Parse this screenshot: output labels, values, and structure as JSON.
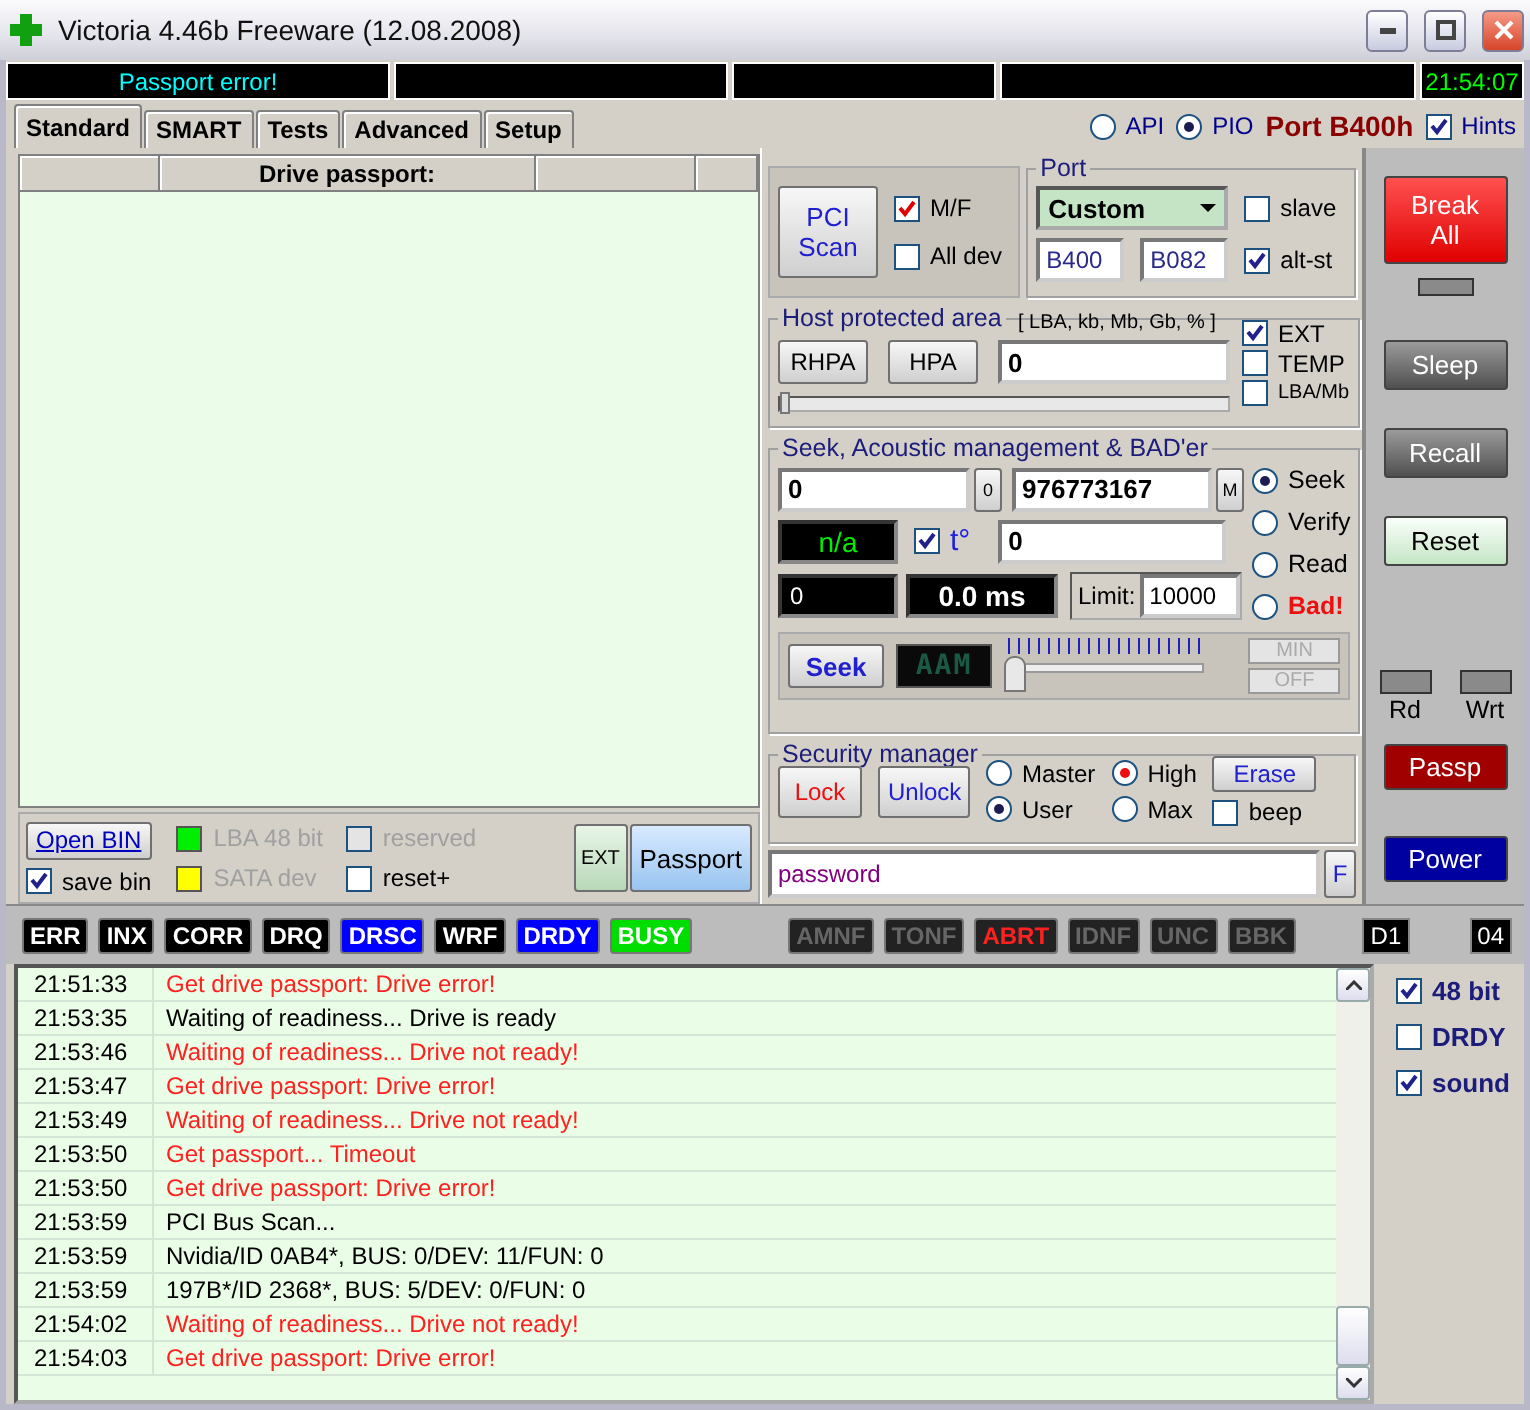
{
  "window": {
    "title": "Victoria 4.46b Freeware (12.08.2008)"
  },
  "status_strip": {
    "message": "Passport error!",
    "clock": "21:54:07"
  },
  "tabs": [
    {
      "label": "Standard",
      "selected": true
    },
    {
      "label": "SMART",
      "selected": false
    },
    {
      "label": "Tests",
      "selected": false
    },
    {
      "label": "Advanced",
      "selected": false
    },
    {
      "label": "Setup",
      "selected": false
    }
  ],
  "access_modes": [
    {
      "label": "API",
      "selected": false
    },
    {
      "label": "PIO",
      "selected": true
    }
  ],
  "port_label": "Port B400h",
  "hints": {
    "label": "Hints",
    "checked": true
  },
  "passport": {
    "title": "Drive passport:"
  },
  "pci": {
    "button": "PCI Scan",
    "options": [
      {
        "label": "M/F",
        "checked": true,
        "kind": "red"
      },
      {
        "label": "All dev",
        "checked": false,
        "kind": "plain"
      }
    ]
  },
  "port": {
    "title": "Port",
    "preset": "Custom",
    "base": "B400",
    "alt": "B082",
    "options": [
      {
        "label": "slave",
        "checked": false
      },
      {
        "label": "alt-st",
        "checked": true
      }
    ]
  },
  "hpa": {
    "title": "Host protected area",
    "units": "[ LBA, kb, Mb, Gb, % ]",
    "buttons": [
      "RHPA",
      "HPA"
    ],
    "value": "0",
    "level": 0,
    "options": [
      {
        "label": "EXT",
        "checked": true
      },
      {
        "label": "TEMP",
        "checked": false
      },
      {
        "label": "LBA/Mb",
        "checked": false
      }
    ]
  },
  "seek": {
    "title": "Seek, Acoustic management & BAD'er",
    "start": "0",
    "start_button": "0",
    "end": "976773167",
    "end_button": "M",
    "temperature": "n/a",
    "temp_option": {
      "label": "t°",
      "checked": true
    },
    "field": "0",
    "counter": "0",
    "time": "0.0 ms",
    "limit_label": "Limit:",
    "limit": "10000",
    "button": "Seek",
    "aam": "AAM",
    "aam_slider": {
      "level": 0
    },
    "min": "MIN",
    "off": "OFF",
    "modes": [
      {
        "label": "Seek",
        "selected": true,
        "kind": "normal"
      },
      {
        "label": "Verify",
        "selected": false,
        "kind": "normal"
      },
      {
        "label": "Read",
        "selected": false,
        "kind": "normal"
      },
      {
        "label": "Bad!",
        "selected": false,
        "kind": "alert"
      }
    ]
  },
  "security": {
    "title": "Security manager",
    "lock": "Lock",
    "unlock": "Unlock",
    "roles": [
      {
        "label": "Master",
        "selected": false
      },
      {
        "label": "User",
        "selected": true
      }
    ],
    "levels": [
      {
        "label": "High",
        "selected": true
      },
      {
        "label": "Max",
        "selected": false
      }
    ],
    "erase": "Erase",
    "beep": {
      "label": "beep",
      "checked": false
    },
    "password": "password",
    "f_button": "F"
  },
  "bottom": {
    "open_bin": "Open BIN",
    "save_bin": {
      "label": "save bin",
      "checked": true
    },
    "indicators": [
      {
        "label": "LBA 48 bit",
        "color": "#00ee00"
      },
      {
        "label": "SATA dev",
        "color": "#ffff00"
      }
    ],
    "options": [
      {
        "label": "reserved",
        "checked": false,
        "disabled": true
      },
      {
        "label": "reset+",
        "checked": false,
        "disabled": false
      }
    ],
    "ext": "EXT",
    "passport": "Passport"
  },
  "side_buttons": [
    {
      "label": "Break All",
      "kind": "danger"
    },
    {
      "label": "Sleep",
      "kind": "dark"
    },
    {
      "label": "Recall",
      "kind": "dark"
    },
    {
      "label": "Reset",
      "kind": "light"
    }
  ],
  "leds": [
    "Rd",
    "Wrt"
  ],
  "side_buttons_lower": [
    {
      "label": "Passp",
      "kind": "maroon"
    },
    {
      "label": "Power",
      "kind": "navy"
    }
  ],
  "flags": [
    {
      "label": "ERR",
      "kind": "lit"
    },
    {
      "label": "INX",
      "kind": "lit"
    },
    {
      "label": "CORR",
      "kind": "lit"
    },
    {
      "label": "DRQ",
      "kind": "lit"
    },
    {
      "label": "DRSC",
      "kind": "blue"
    },
    {
      "label": "WRF",
      "kind": "lit"
    },
    {
      "label": "DRDY",
      "kind": "blue"
    },
    {
      "label": "BUSY",
      "kind": "green"
    }
  ],
  "errors": [
    {
      "label": "AMNF",
      "kind": "dim"
    },
    {
      "label": "TONF",
      "kind": "dim"
    },
    {
      "label": "ABRT",
      "kind": "alert"
    },
    {
      "label": "IDNF",
      "kind": "dim"
    },
    {
      "label": "UNC",
      "kind": "dim"
    },
    {
      "label": "BBK",
      "kind": "dim"
    }
  ],
  "registers": [
    "D1",
    "04"
  ],
  "log": [
    {
      "time": "21:51:33",
      "text": "Get drive passport: Drive error!",
      "kind": "error"
    },
    {
      "time": "21:53:35",
      "text": "Waiting of readiness... Drive is ready",
      "kind": "info"
    },
    {
      "time": "21:53:46",
      "text": "Waiting of readiness... Drive not ready!",
      "kind": "error"
    },
    {
      "time": "21:53:47",
      "text": "Get drive passport: Drive error!",
      "kind": "error"
    },
    {
      "time": "21:53:49",
      "text": "Waiting of readiness... Drive not ready!",
      "kind": "error"
    },
    {
      "time": "21:53:50",
      "text": "Get passport... Timeout",
      "kind": "error"
    },
    {
      "time": "21:53:50",
      "text": "Get drive passport: Drive error!",
      "kind": "error"
    },
    {
      "time": "21:53:59",
      "text": "PCI Bus Scan...",
      "kind": "info"
    },
    {
      "time": "21:53:59",
      "text": "Nvidia/ID 0AB4*, BUS: 0/DEV: 11/FUN: 0",
      "kind": "info"
    },
    {
      "time": "21:53:59",
      "text": "197B*/ID 2368*, BUS: 5/DEV: 0/FUN: 0",
      "kind": "info"
    },
    {
      "time": "21:54:02",
      "text": "Waiting of readiness... Drive not ready!",
      "kind": "error"
    },
    {
      "time": "21:54:03",
      "text": "Get drive passport: Drive error!",
      "kind": "error"
    }
  ],
  "log_options": [
    {
      "label": "48 bit",
      "checked": true
    },
    {
      "label": "DRDY",
      "checked": false
    },
    {
      "label": "sound",
      "checked": true
    }
  ]
}
